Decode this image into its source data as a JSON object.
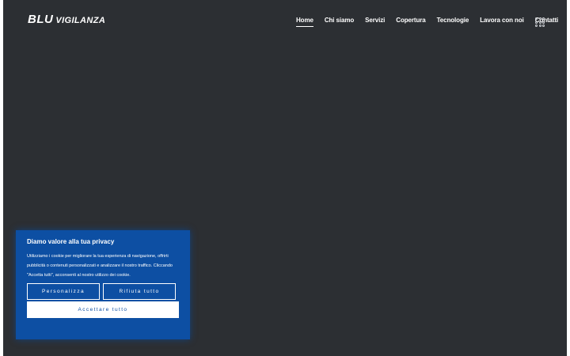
{
  "brand": {
    "logo_primary": "BLU",
    "logo_secondary": "VIGILANZA"
  },
  "nav": {
    "items": [
      "Home",
      "Chi siamo",
      "Servizi",
      "Copertura",
      "Tecnologie",
      "Lavora con noi",
      "Contatti"
    ],
    "active": "Home",
    "menu_icon": "grid-menu-icon"
  },
  "cookie_banner": {
    "title": "Diamo valore alla tua privacy",
    "text": "Utilizziamo i cookie per migliorare la tua esperienza di navigazione, offrirti pubblicità o contenuti personalizzati e analizzare il nostro traffico. Cliccando \"Accetta tutti\", acconsenti al nostro utilizzo dei cookie.",
    "customize_label": "Personalizza",
    "reject_label": "Rifiuta tutto",
    "accept_label": "Accettare tutto"
  },
  "colors": {
    "background": "#2c2f33",
    "banner": "#0d4fa3",
    "text": "#ffffff"
  }
}
